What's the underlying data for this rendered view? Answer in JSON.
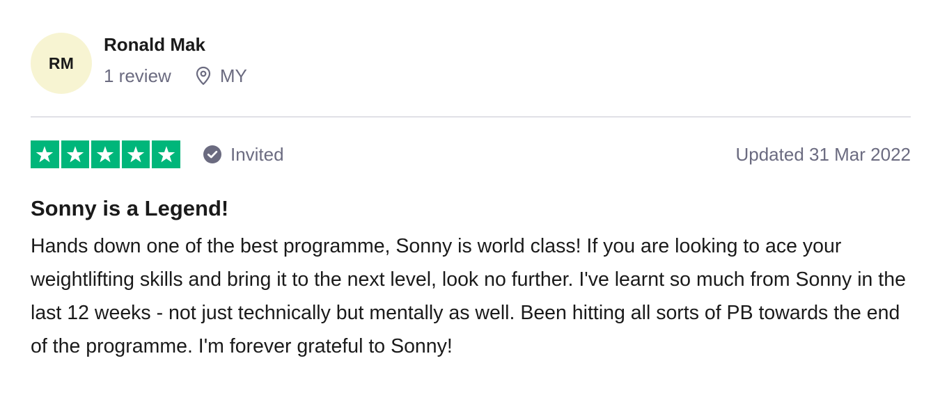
{
  "reviewer": {
    "initials": "RM",
    "avatar_color": "#f7f4d2",
    "name": "Ronald Mak",
    "review_count": "1 review",
    "location_icon": "location-pin-icon",
    "country": "MY"
  },
  "rating": {
    "stars": 5,
    "max_stars": 5,
    "star_color": "#00b67a",
    "verification_icon": "check-circle-icon",
    "verification_label": "Invited",
    "updated_date": "Updated 31 Mar 2022"
  },
  "review": {
    "title": "Sonny is a Legend!",
    "body": "Hands down one of the best programme, Sonny is world class! If you are looking to ace your weightlifting skills and bring it to the next level, look no further. I've learnt so much from Sonny in the last 12 weeks - not just technically but mentally as well. Been hitting all sorts of PB towards the end of the programme. I'm forever grateful to Sonny!"
  }
}
